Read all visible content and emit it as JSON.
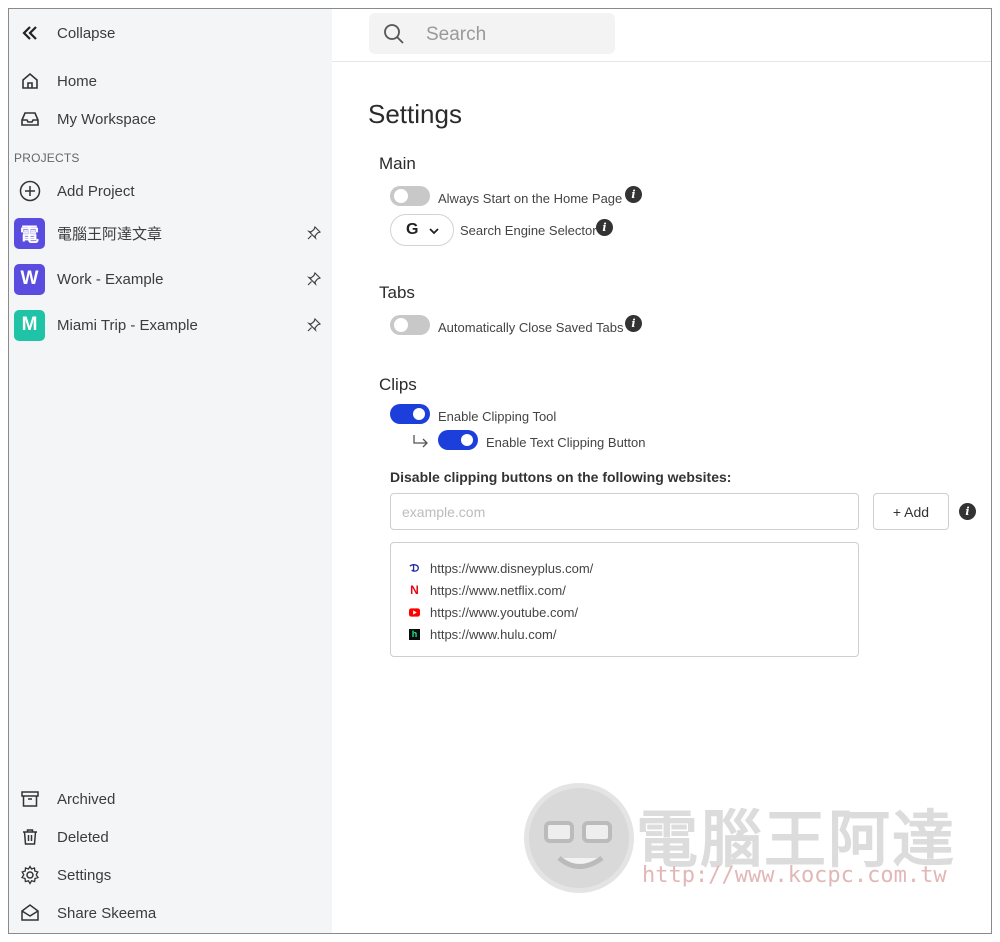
{
  "sidebar": {
    "collapse_label": "Collapse",
    "nav": [
      {
        "label": "Home",
        "icon": "home-icon"
      },
      {
        "label": "My Workspace",
        "icon": "inbox-icon"
      }
    ],
    "projects_heading": "PROJECTS",
    "add_project_label": "Add Project",
    "projects": [
      {
        "letter": "電",
        "name": "電腦王阿達文章",
        "color": "#5b4ce0"
      },
      {
        "letter": "W",
        "name": "Work - Example",
        "color": "#5b4ce0"
      },
      {
        "letter": "M",
        "name": "Miami Trip - Example",
        "color": "#1fc3a5"
      }
    ],
    "bottom": [
      {
        "label": "Archived",
        "icon": "archive-icon"
      },
      {
        "label": "Deleted",
        "icon": "trash-icon"
      },
      {
        "label": "Settings",
        "icon": "gear-icon"
      },
      {
        "label": "Share Skeema",
        "icon": "share-icon"
      }
    ]
  },
  "search": {
    "placeholder": "Search"
  },
  "settings": {
    "title": "Settings",
    "main": {
      "heading": "Main",
      "always_start_label": "Always Start on the Home Page",
      "always_start_on": false,
      "search_engine_value": "G",
      "search_engine_label": "Search Engine Selector"
    },
    "tabs": {
      "heading": "Tabs",
      "auto_close_label": "Automatically Close Saved Tabs",
      "auto_close_on": false
    },
    "clips": {
      "heading": "Clips",
      "clipping_tool_label": "Enable Clipping Tool",
      "clipping_tool_on": true,
      "text_clipping_label": "Enable Text Clipping Button",
      "text_clipping_on": true,
      "disable_label": "Disable clipping buttons on the following websites:",
      "input_placeholder": "example.com",
      "add_label": "+ Add",
      "sites": [
        {
          "url": "https://www.disneyplus.com/",
          "icon": "disney-icon"
        },
        {
          "url": "https://www.netflix.com/",
          "icon": "netflix-icon"
        },
        {
          "url": "https://www.youtube.com/",
          "icon": "youtube-icon"
        },
        {
          "url": "https://www.hulu.com/",
          "icon": "hulu-icon"
        }
      ]
    }
  },
  "watermark": {
    "title": "電腦王阿達",
    "url": "http://www.kocpc.com.tw"
  },
  "colors": {
    "accent": "#1c3fdb",
    "toggle_off": "#c8c8c8",
    "sidebar_bg": "#f4f5f7"
  }
}
